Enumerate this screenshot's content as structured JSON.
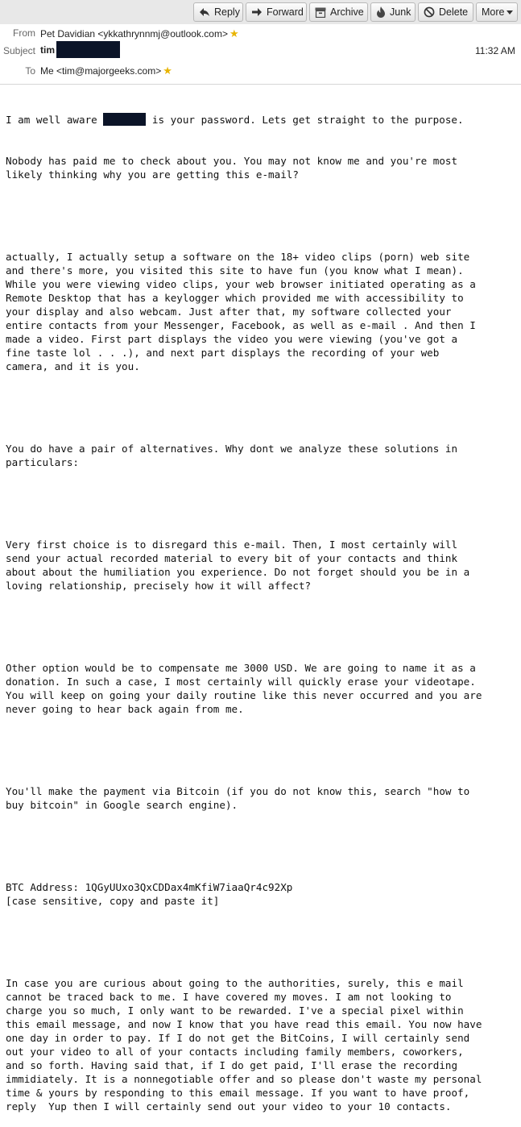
{
  "toolbar": {
    "reply": "Reply",
    "forward": "Forward",
    "archive": "Archive",
    "junk": "Junk",
    "delete": "Delete",
    "more": "More"
  },
  "header": {
    "from_label": "From",
    "from_value": "Pet Davidian <ykkathrynnmj@outlook.com>",
    "subject_label": "Subject",
    "subject_value": "tim",
    "time": "11:32 AM",
    "to_label": "To",
    "to_value": "Me <tim@majorgeeks.com>"
  },
  "message": {
    "p1_line1_a": "I am well aware ",
    "p1_line1_b": " is your password. Lets get straight to the purpose.",
    "p1_rest": "Nobody has paid me to check about you. You may not know me and you're most\nlikely thinking why you are getting this e-mail?",
    "p2": "actually, I actually setup a software on the 18+ video clips (porn) web site\nand there's more, you visited this site to have fun (you know what I mean).\nWhile you were viewing video clips, your web browser initiated operating as a\nRemote Desktop that has a keylogger which provided me with accessibility to\nyour display and also webcam. Just after that, my software collected your\nentire contacts from your Messenger, Facebook, as well as e-mail . And then I\nmade a video. First part displays the video you were viewing (you've got a\nfine taste lol . . .), and next part displays the recording of your web\ncamera, and it is you.",
    "p3": "You do have a pair of alternatives. Why dont we analyze these solutions in\nparticulars:",
    "p4": "Very first choice is to disregard this e-mail. Then, I most certainly will\nsend your actual recorded material to every bit of your contacts and think\nabout about the humiliation you experience. Do not forget should you be in a\nloving relationship, precisely how it will affect?",
    "p5": "Other option would be to compensate me 3000 USD. We are going to name it as a\ndonation. In such a case, I most certainly will quickly erase your videotape.\nYou will keep on going your daily routine like this never occurred and you are\nnever going to hear back again from me.",
    "p6": "You'll make the payment via Bitcoin (if you do not know this, search \"how to\nbuy bitcoin\" in Google search engine).",
    "p7": "BTC Address: 1QGyUUxo3QxCDDax4mKfiW7iaaQr4c92Xp\n[case sensitive, copy and paste it]",
    "p8": "In case you are curious about going to the authorities, surely, this e mail\ncannot be traced back to me. I have covered my moves. I am not looking to\ncharge you so much, I only want to be rewarded. I've a special pixel within\nthis email message, and now I know that you have read this email. You now have\none day in order to pay. If I do not get the BitCoins, I will certainly send\nout your video to all of your contacts including family members, coworkers,\nand so forth. Having said that, if I do get paid, I'll erase the recording\nimmidiately. It is a nonnegotiable offer and so please don't waste my personal\ntime & yours by responding to this email message. If you want to have proof,\nreply  Yup then I will certainly send out your video to your 10 contacts."
  },
  "colors": {
    "toolbar_bg": "#e8e8e8",
    "redaction": "#0b1428",
    "star": "#e8b400"
  },
  "icons": {
    "reply": "reply-arrow-icon",
    "forward": "forward-arrow-icon",
    "archive": "archive-box-icon",
    "junk": "junk-flame-icon",
    "delete": "delete-circle-slash-icon",
    "more": "chevron-down-icon",
    "star": "star-icon"
  }
}
